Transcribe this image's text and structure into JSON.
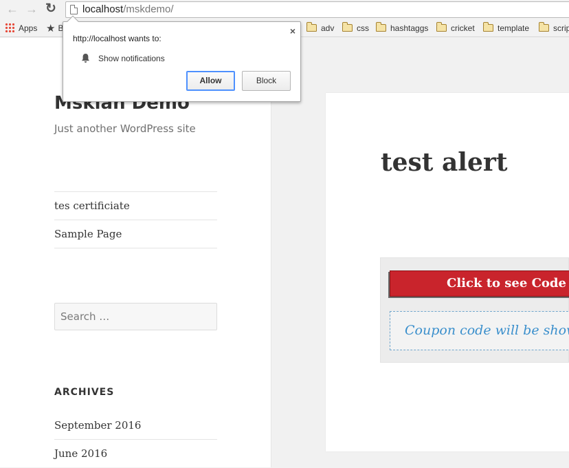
{
  "browser": {
    "url_host": "localhost",
    "url_path": "/mskdemo/",
    "bookmarks": [
      {
        "label": "Apps",
        "icon": "apps-grid-icon"
      },
      {
        "label": "B",
        "icon": "star-icon"
      },
      {
        "label": "adv",
        "icon": "folder-icon"
      },
      {
        "label": "css",
        "icon": "folder-icon"
      },
      {
        "label": "hashtaggs",
        "icon": "folder-icon"
      },
      {
        "label": "cricket",
        "icon": "folder-icon"
      },
      {
        "label": "template",
        "icon": "folder-icon"
      },
      {
        "label": "scrip",
        "icon": "folder-icon"
      }
    ]
  },
  "permission_popup": {
    "origin_text": "http://localhost wants to:",
    "permission": "Show notifications",
    "allow_label": "Allow",
    "block_label": "Block",
    "close_glyph": "×"
  },
  "site": {
    "title": "Mskian Demo",
    "tagline": "Just another WordPress site",
    "menu": [
      "tes certificiate",
      "Sample Page"
    ],
    "search_placeholder": "Search …",
    "archives_heading": "ARCHIVES",
    "archives": [
      "September 2016",
      "June 2016"
    ]
  },
  "post": {
    "title": "test alert",
    "coupon_button": "Click to see Code &",
    "coupon_note": "Coupon code will be shown"
  },
  "colors": {
    "coupon_button": "#c9242c",
    "coupon_note": "#3a8fcc",
    "allow_focus": "#4d90fe"
  }
}
